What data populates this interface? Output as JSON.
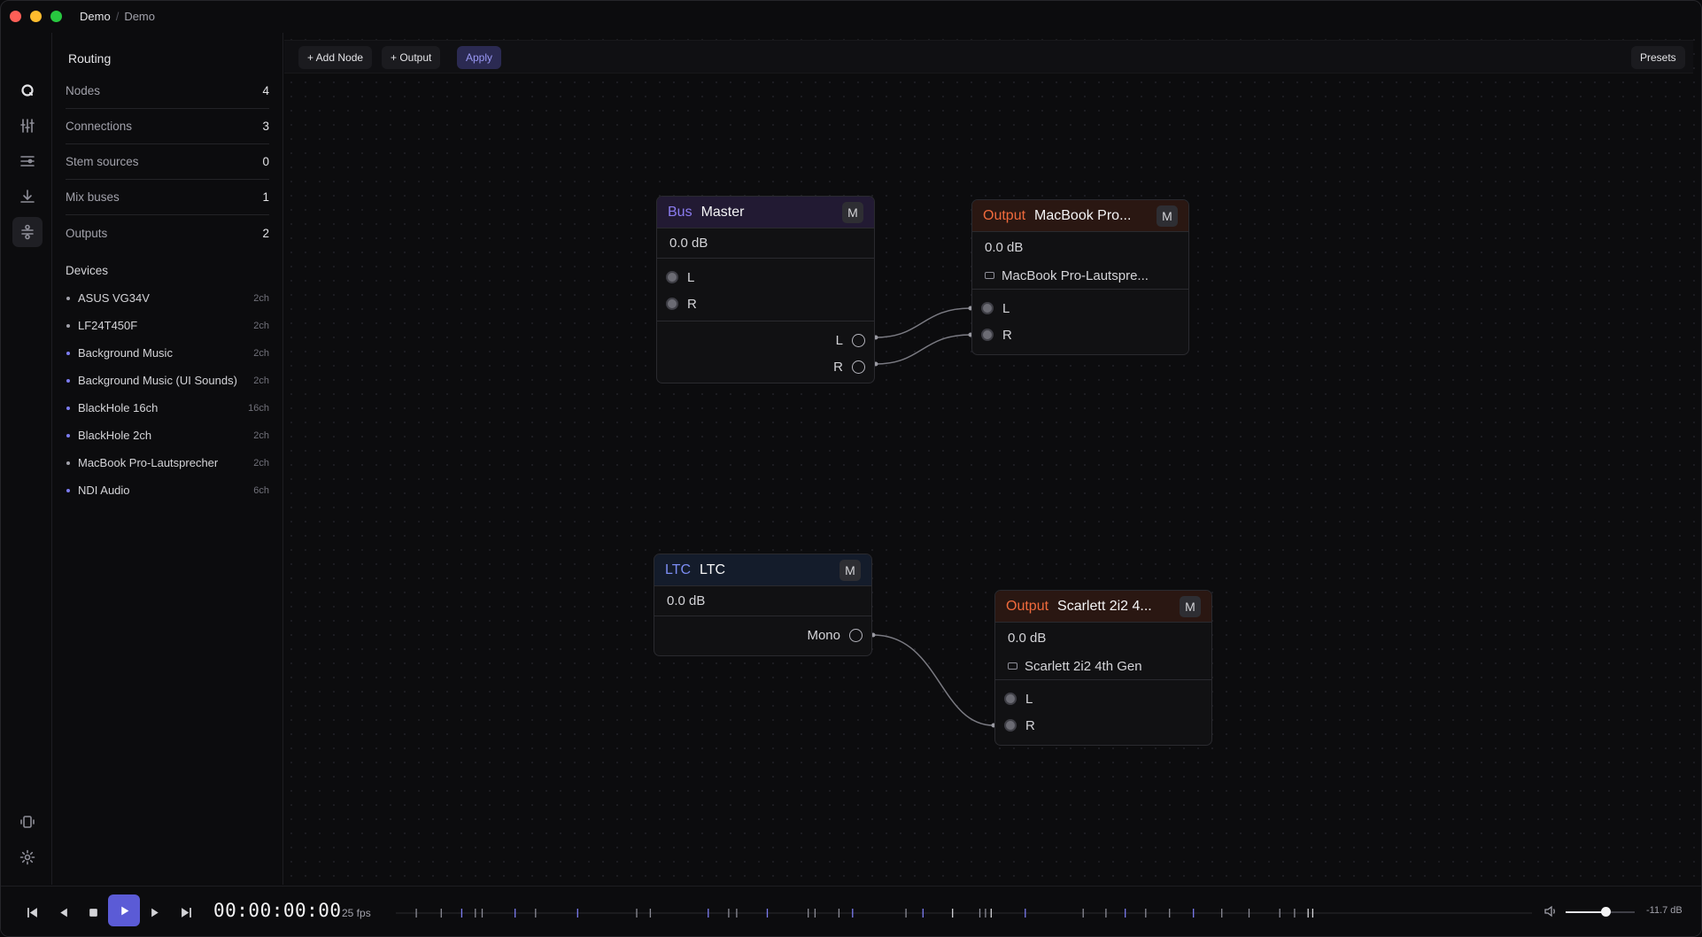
{
  "breadcrumb": {
    "workspace": "Demo",
    "separator": "/",
    "project": "Demo"
  },
  "rail": {
    "items": [
      {
        "icon": "logo-icon"
      },
      {
        "icon": "mixer-sliders-icon"
      },
      {
        "icon": "filter-list-icon"
      },
      {
        "icon": "download-icon"
      },
      {
        "icon": "routing-icon",
        "active": true
      }
    ],
    "bottom": [
      {
        "icon": "device-icon"
      },
      {
        "icon": "gear-icon"
      }
    ]
  },
  "sidebar": {
    "title": "Routing",
    "stats": [
      {
        "label": "Nodes",
        "value": "4"
      },
      {
        "label": "Connections",
        "value": "3"
      },
      {
        "label": "Stem sources",
        "value": "0"
      },
      {
        "label": "Mix buses",
        "value": "1"
      },
      {
        "label": "Outputs",
        "value": "2"
      }
    ],
    "devices_title": "Devices",
    "devices": [
      {
        "name": "ASUS VG34V",
        "channels": "2ch",
        "dot_color": "#a1a1aa"
      },
      {
        "name": "LF24T450F",
        "channels": "2ch",
        "dot_color": "#a1a1aa"
      },
      {
        "name": "Background Music",
        "channels": "2ch",
        "dot_color": "#7c7cf0"
      },
      {
        "name": "Background Music (UI Sounds)",
        "channels": "2ch",
        "dot_color": "#7c7cf0"
      },
      {
        "name": "BlackHole 16ch",
        "channels": "16ch",
        "dot_color": "#7c7cf0"
      },
      {
        "name": "BlackHole 2ch",
        "channels": "2ch",
        "dot_color": "#7c7cf0"
      },
      {
        "name": "MacBook Pro-Lautsprecher",
        "channels": "2ch",
        "dot_color": "#a1a1aa"
      },
      {
        "name": "NDI Audio",
        "channels": "6ch",
        "dot_color": "#7c7cf0"
      }
    ]
  },
  "toolbar": {
    "add_node": "+ Add Node",
    "add_output": "+ Output",
    "apply": "Apply",
    "presets": "Presets"
  },
  "nodes": {
    "master": {
      "kind": "Bus",
      "name": "Master",
      "mute": "M",
      "gain": "0.0 dB",
      "inputs": [
        "L",
        "R"
      ],
      "outputs": [
        "L",
        "R"
      ]
    },
    "macbook": {
      "kind": "Output",
      "name": "MacBook Pro...",
      "mute": "M",
      "gain": "0.0 dB",
      "device": "MacBook Pro-Lautspre...",
      "inputs": [
        "L",
        "R"
      ]
    },
    "ltc": {
      "kind": "LTC",
      "name": "LTC",
      "mute": "M",
      "gain": "0.0 dB",
      "outputs": [
        "Mono"
      ]
    },
    "scarlett": {
      "kind": "Output",
      "name": "Scarlett 2i2 4...",
      "mute": "M",
      "gain": "0.0 dB",
      "device": "Scarlett 2i2 4th Gen",
      "inputs": [
        "L",
        "R"
      ]
    }
  },
  "connections": [
    {
      "from": "master.L",
      "to": "macbook.L"
    },
    {
      "from": "master.R",
      "to": "macbook.R"
    },
    {
      "from": "ltc.Mono",
      "to": "scarlett.R"
    }
  ],
  "transport": {
    "timecode": "00:00:00:00",
    "fps": "25 fps",
    "volume_level": 0.58,
    "volume_db": "-11.7 dB",
    "markers": [
      {
        "pos": 0.018,
        "c": "#8a8a94"
      },
      {
        "pos": 0.04,
        "c": "#8a8a94"
      },
      {
        "pos": 0.058,
        "c": "#7c7cf0"
      },
      {
        "pos": 0.07,
        "c": "#8a8a94"
      },
      {
        "pos": 0.076,
        "c": "#8a8a94"
      },
      {
        "pos": 0.105,
        "c": "#7c7cf0"
      },
      {
        "pos": 0.123,
        "c": "#8a8a94"
      },
      {
        "pos": 0.16,
        "c": "#7c7cf0"
      },
      {
        "pos": 0.212,
        "c": "#8a8a94"
      },
      {
        "pos": 0.224,
        "c": "#8a8a94"
      },
      {
        "pos": 0.275,
        "c": "#7c7cf0"
      },
      {
        "pos": 0.293,
        "c": "#8a8a94"
      },
      {
        "pos": 0.3,
        "c": "#8a8a94"
      },
      {
        "pos": 0.327,
        "c": "#7c7cf0"
      },
      {
        "pos": 0.363,
        "c": "#8a8a94"
      },
      {
        "pos": 0.369,
        "c": "#8a8a94"
      },
      {
        "pos": 0.39,
        "c": "#8a8a94"
      },
      {
        "pos": 0.402,
        "c": "#7c7cf0"
      },
      {
        "pos": 0.449,
        "c": "#8a8a94"
      },
      {
        "pos": 0.464,
        "c": "#7c7cf0"
      },
      {
        "pos": 0.49,
        "c": "#d4d4d8"
      },
      {
        "pos": 0.514,
        "c": "#8a8a94"
      },
      {
        "pos": 0.519,
        "c": "#8a8a94"
      },
      {
        "pos": 0.524,
        "c": "#d4d4d8"
      },
      {
        "pos": 0.554,
        "c": "#7c7cf0"
      },
      {
        "pos": 0.605,
        "c": "#8a8a94"
      },
      {
        "pos": 0.625,
        "c": "#8a8a94"
      },
      {
        "pos": 0.642,
        "c": "#7c7cf0"
      },
      {
        "pos": 0.66,
        "c": "#8a8a94"
      },
      {
        "pos": 0.681,
        "c": "#8a8a94"
      },
      {
        "pos": 0.702,
        "c": "#7c7cf0"
      },
      {
        "pos": 0.727,
        "c": "#8a8a94"
      },
      {
        "pos": 0.751,
        "c": "#8a8a94"
      },
      {
        "pos": 0.778,
        "c": "#8a8a94"
      },
      {
        "pos": 0.791,
        "c": "#8a8a94"
      },
      {
        "pos": 0.803,
        "c": "#d4d4d8"
      },
      {
        "pos": 0.807,
        "c": "#d4d4d8"
      }
    ]
  }
}
